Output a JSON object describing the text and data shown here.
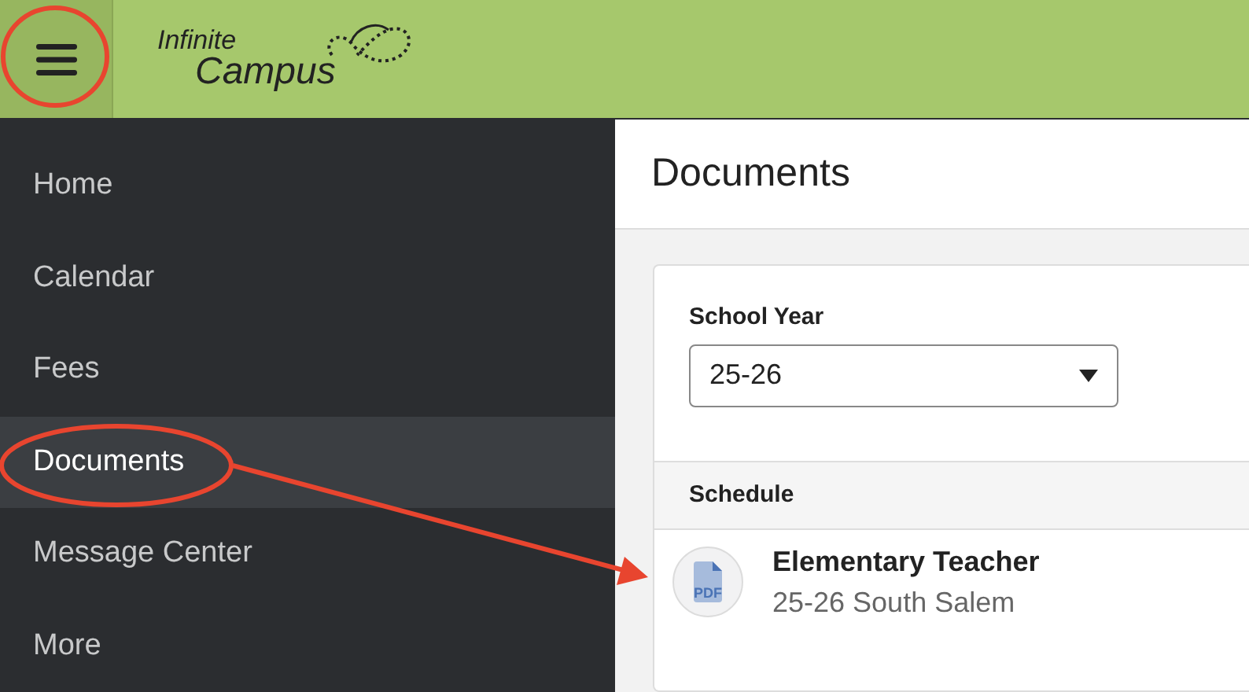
{
  "header": {
    "logo": {
      "line_1": "Infinite",
      "line_2": "Campus"
    }
  },
  "sidebar": {
    "items": [
      {
        "label": "Home",
        "selected": false
      },
      {
        "label": "Calendar",
        "selected": false
      },
      {
        "label": "Fees",
        "selected": false
      },
      {
        "label": "Documents",
        "selected": true
      },
      {
        "label": "Message Center",
        "selected": false
      },
      {
        "label": "More",
        "selected": false
      }
    ]
  },
  "page": {
    "title": "Documents",
    "school_year": {
      "label": "School Year",
      "value": "25-26"
    },
    "sections": [
      {
        "title": "Schedule",
        "documents": [
          {
            "title": "Elementary Teacher",
            "subtitle": "25-26 South Salem",
            "icon_label": "PDF"
          }
        ]
      }
    ]
  }
}
